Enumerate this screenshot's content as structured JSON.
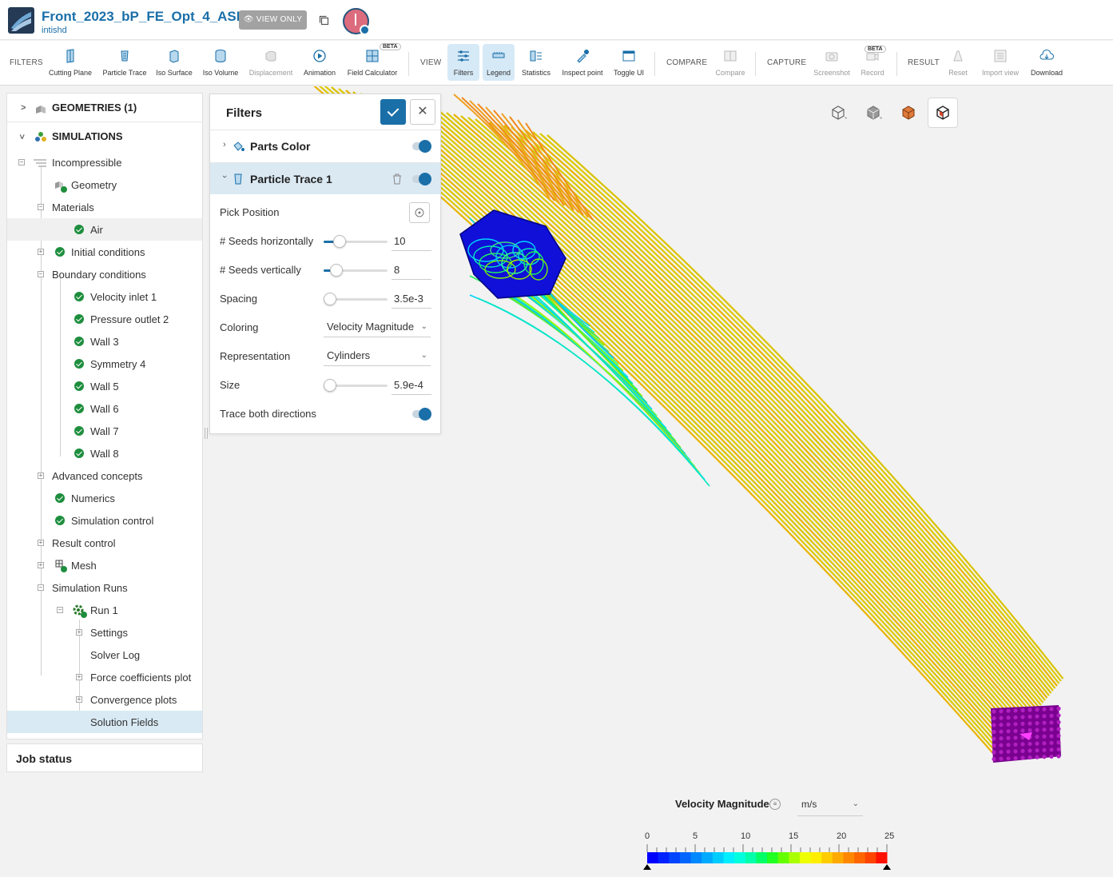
{
  "header": {
    "project_title": "Front_2023_bP_FE_Opt_4_ASM",
    "owner": "intishd",
    "view_only_label": "VIEW ONLY",
    "avatar_color": "#dc6b7d"
  },
  "toolbar": {
    "filters_group": "FILTERS",
    "view_group": "VIEW",
    "compare_group": "COMPARE",
    "capture_group": "CAPTURE",
    "result_group": "RESULT",
    "beta_label": "BETA",
    "items": {
      "cutting_plane": "Cutting Plane",
      "particle_trace": "Particle Trace",
      "iso_surface": "Iso Surface",
      "iso_volume": "Iso Volume",
      "displacement": "Displacement",
      "animation": "Animation",
      "field_calculator": "Field Calculator",
      "filters": "Filters",
      "legend": "Legend",
      "statistics": "Statistics",
      "inspect_point": "Inspect point",
      "toggle_ui": "Toggle UI",
      "compare": "Compare",
      "screenshot": "Screenshot",
      "record": "Record",
      "reset": "Reset",
      "import_view": "Import view",
      "download": "Download"
    }
  },
  "tree": {
    "geometries": "GEOMETRIES (1)",
    "simulations": "SIMULATIONS",
    "incompressible": "Incompressible",
    "geometry": "Geometry",
    "materials": "Materials",
    "air": "Air",
    "initial_conditions": "Initial conditions",
    "boundary_conditions": "Boundary conditions",
    "bc_items": [
      "Velocity inlet 1",
      "Pressure outlet 2",
      "Wall 3",
      "Symmetry 4",
      "Wall 5",
      "Wall 6",
      "Wall 7",
      "Wall 8"
    ],
    "advanced_concepts": "Advanced concepts",
    "numerics": "Numerics",
    "simulation_control": "Simulation control",
    "result_control": "Result control",
    "mesh": "Mesh",
    "simulation_runs": "Simulation Runs",
    "run1": "Run 1",
    "settings": "Settings",
    "solver_log": "Solver Log",
    "force_coefficients_plot": "Force coefficients plot",
    "convergence_plots": "Convergence plots",
    "solution_fields": "Solution Fields"
  },
  "job_status": "Job status",
  "filters_panel": {
    "title": "Filters",
    "parts_color": "Parts Color",
    "particle_trace": "Particle Trace 1",
    "pick_position": "Pick Position",
    "seeds_h_label": "# Seeds horizontally",
    "seeds_h_value": "10",
    "seeds_v_label": "# Seeds vertically",
    "seeds_v_value": "8",
    "spacing_label": "Spacing",
    "spacing_value": "3.5e-3",
    "coloring_label": "Coloring",
    "coloring_value": "Velocity Magnitude",
    "representation_label": "Representation",
    "representation_value": "Cylinders",
    "size_label": "Size",
    "size_value": "5.9e-4",
    "trace_both_label": "Trace both directions"
  },
  "legend": {
    "title": "Velocity Magnitude",
    "unit": "m/s",
    "ticks": [
      "0",
      "5",
      "10",
      "15",
      "20",
      "25"
    ],
    "colors": [
      "#0000ff",
      "#0022ff",
      "#0044ff",
      "#0066ff",
      "#0088ff",
      "#00aaff",
      "#00ccff",
      "#00eeff",
      "#00ffdd",
      "#00ffaa",
      "#00ff66",
      "#22ff22",
      "#66ff00",
      "#aaff00",
      "#eeff00",
      "#ffee00",
      "#ffcc00",
      "#ffaa00",
      "#ff8800",
      "#ff6600",
      "#ff4400",
      "#ff1100"
    ]
  },
  "colors": {
    "accent": "#1a6fa8",
    "success": "#1e8e3e"
  }
}
